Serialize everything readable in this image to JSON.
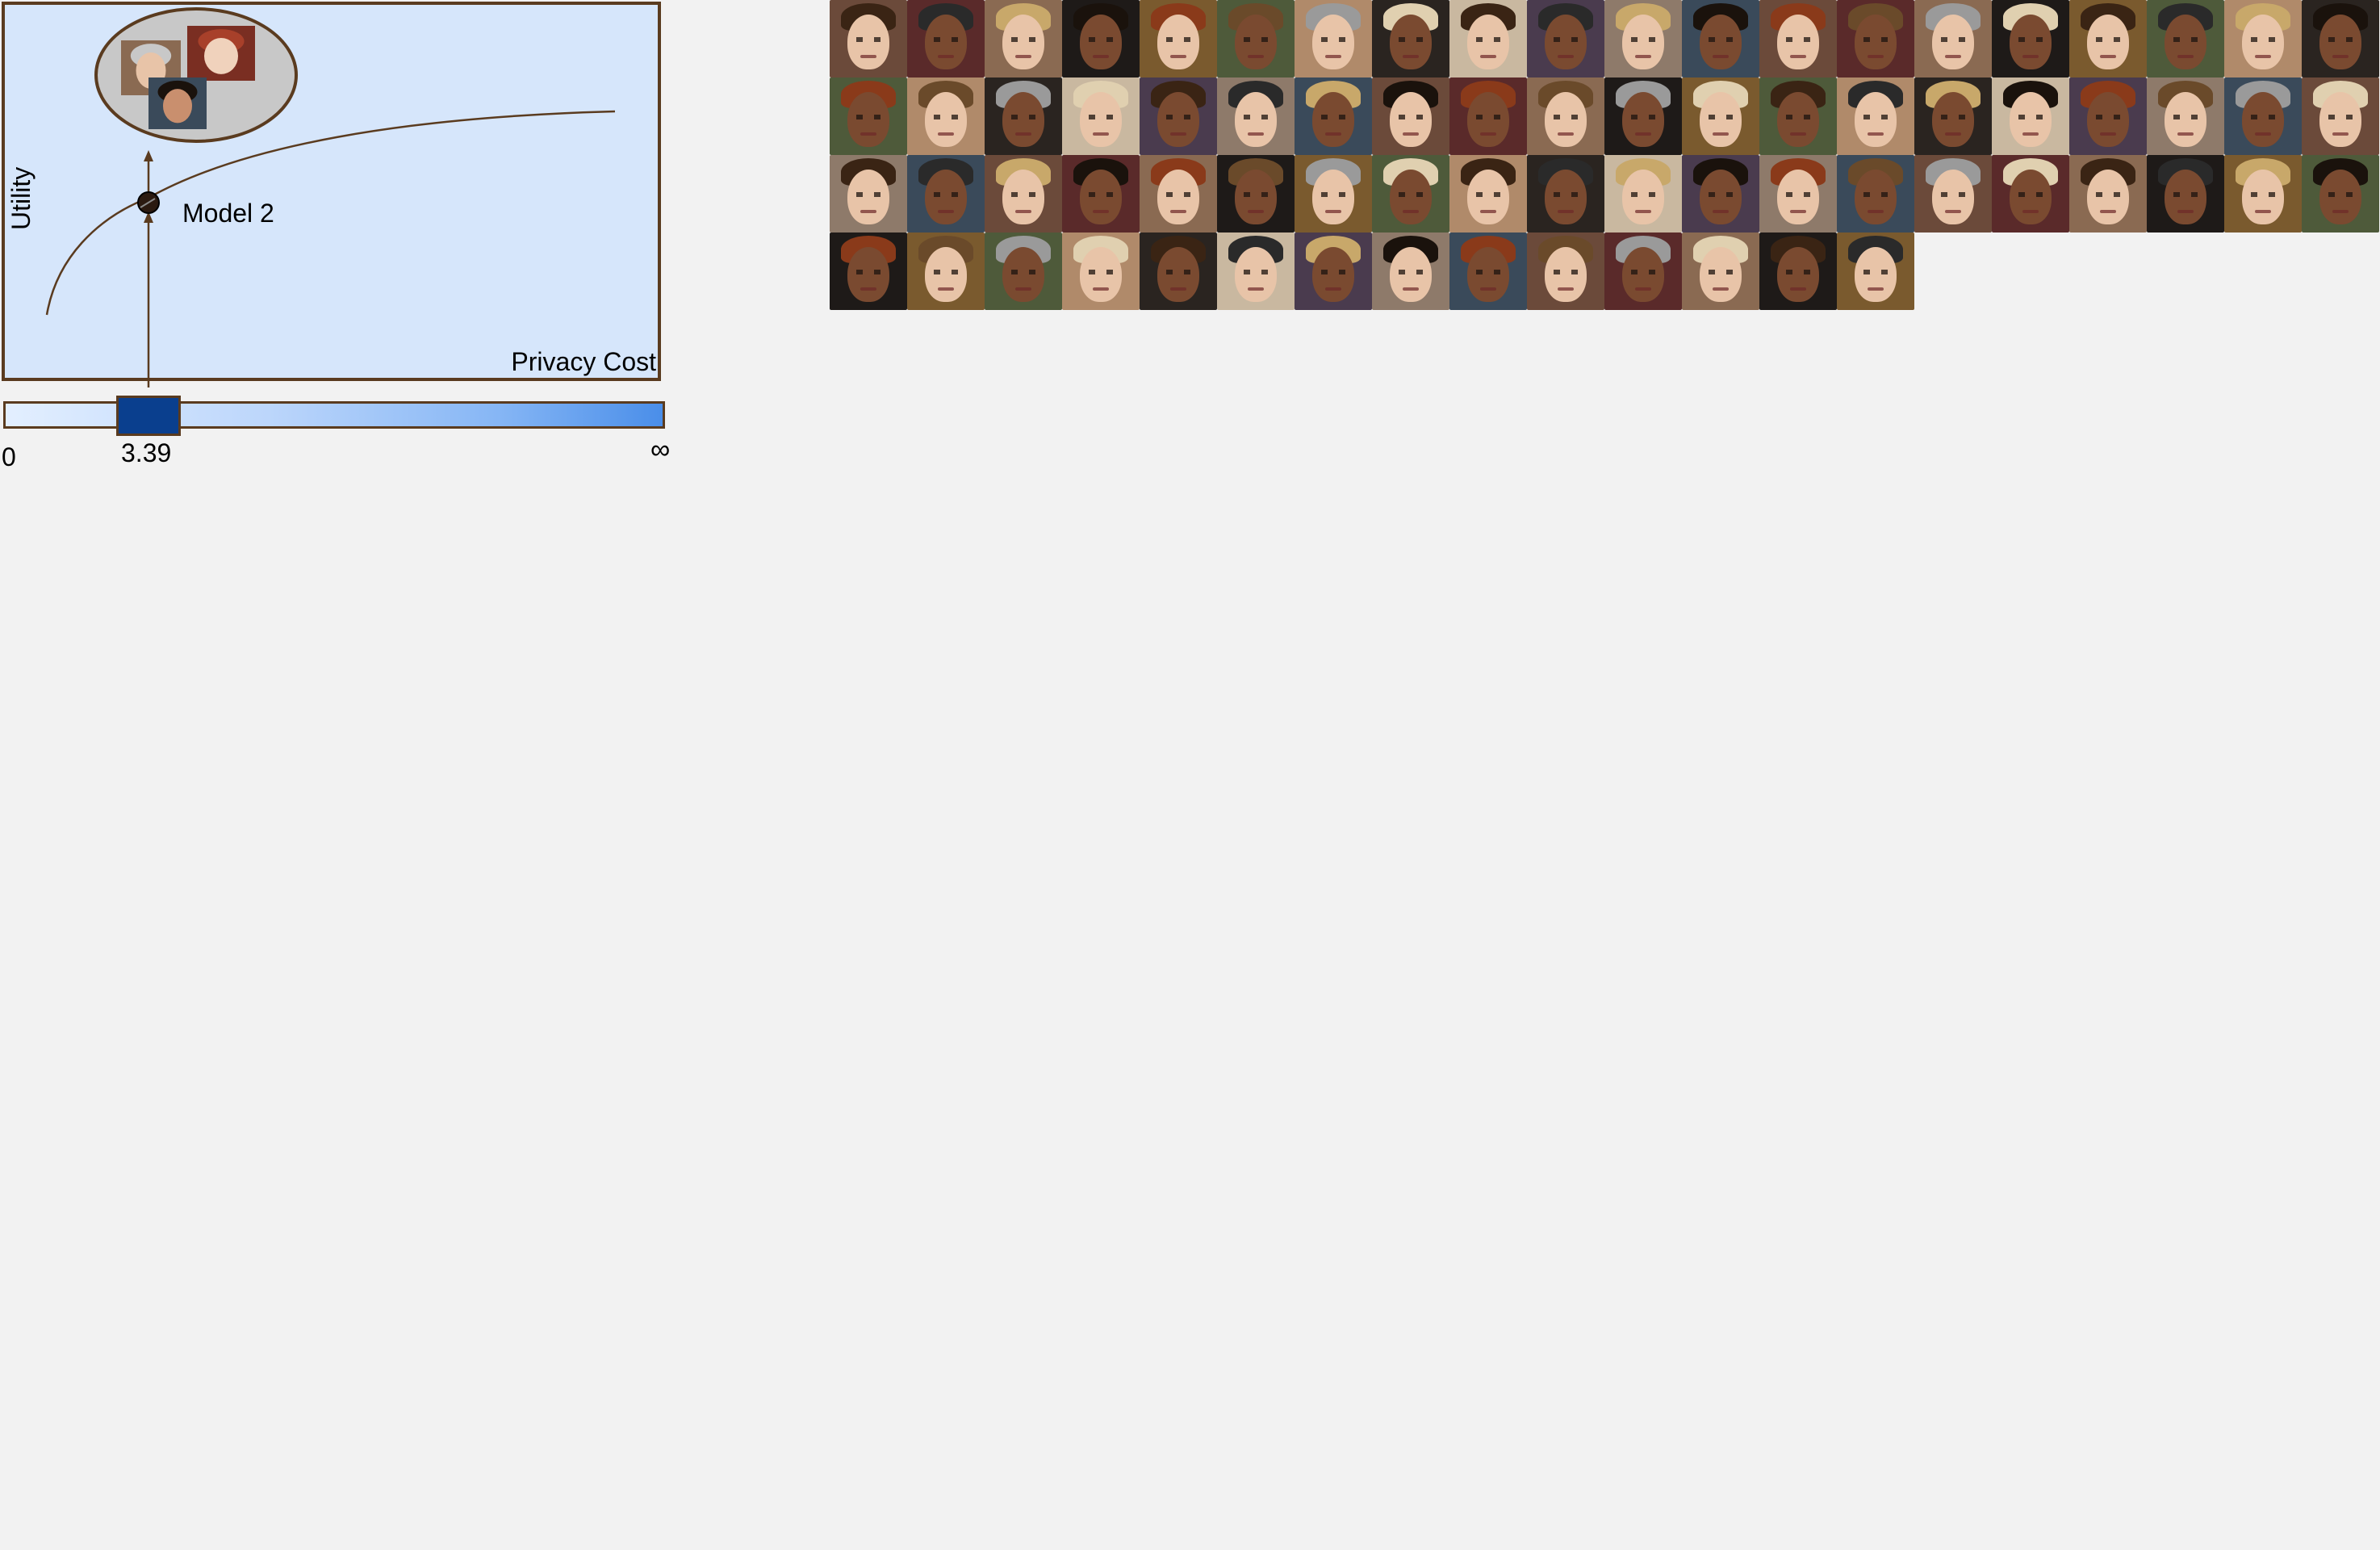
{
  "figure": {
    "y_axis_label": "Utility",
    "x_axis_label": "Privacy Cost",
    "model_label": "Model 2"
  },
  "slider": {
    "min_label": "0",
    "value_label": "3.39",
    "max_label": "∞",
    "value": 3.39
  },
  "colors": {
    "page_background": "#f2f2f2",
    "plot_background": "#d6e6fb",
    "border_brown": "#5a3b1f",
    "slider_thumb": "#0a3f8e",
    "ellipse_fill": "#c8c8c8"
  },
  "face_grid": {
    "rows": 4,
    "columns": 20,
    "count": 74
  },
  "selected_faces": {
    "count": 3
  }
}
